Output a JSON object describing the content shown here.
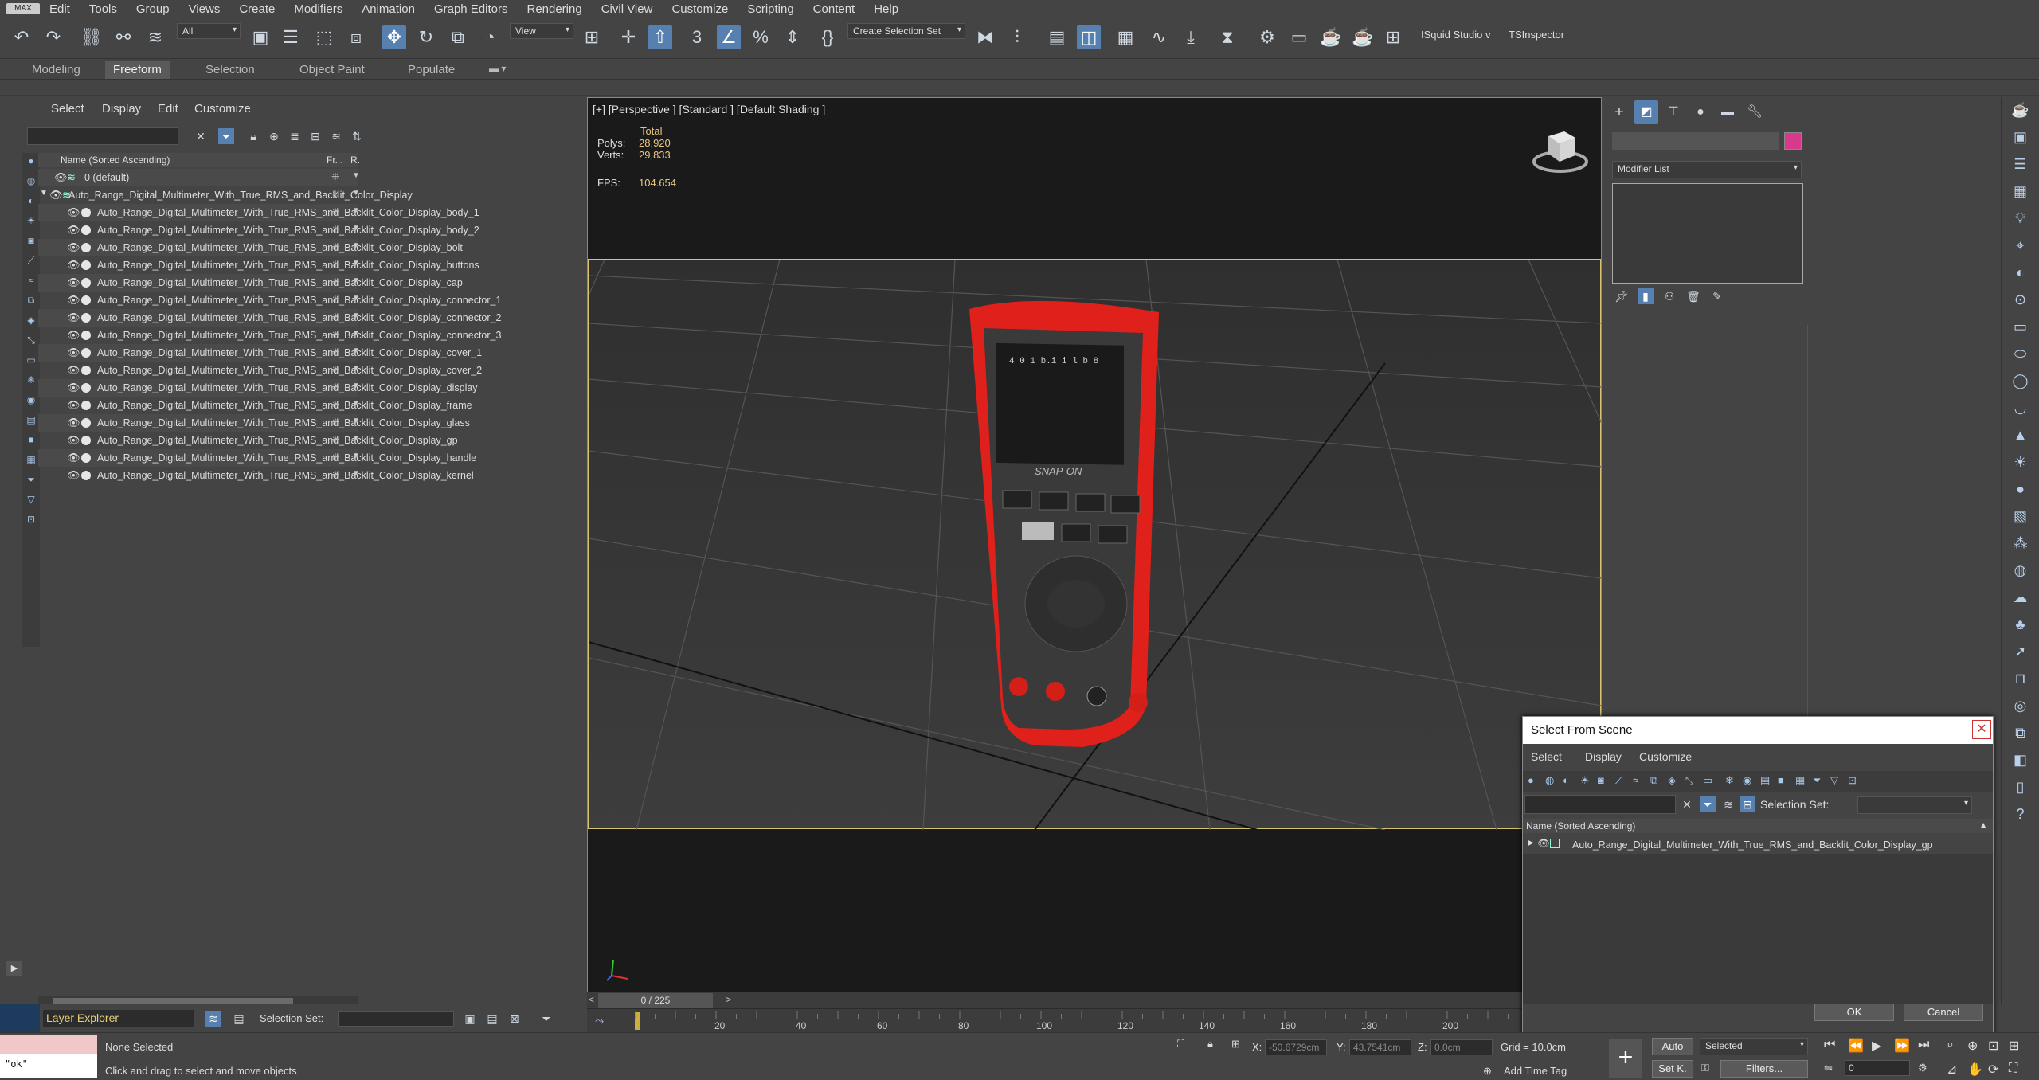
{
  "menubar": {
    "logo": "MAX",
    "items": [
      "Edit",
      "Tools",
      "Group",
      "Views",
      "Create",
      "Modifiers",
      "Animation",
      "Graph Editors",
      "Rendering",
      "Civil View",
      "Customize",
      "Scripting",
      "Content",
      "Help"
    ]
  },
  "toolbar": {
    "filter_value": "All",
    "view_value": "View",
    "selection_set_value": "Create Selection Set",
    "plugin1": "ISquid Studio v",
    "plugin2": "TSInspector"
  },
  "ribbon": {
    "tabs": [
      "Modeling",
      "Freeform",
      "Selection",
      "Object Paint",
      "Populate"
    ],
    "selected_tab": "Freeform"
  },
  "explorer": {
    "menu": [
      "Select",
      "Display",
      "Edit",
      "Customize"
    ],
    "header_name": "Name (Sorted Ascending)",
    "header_frozen": "Fr...",
    "header_r": "R.",
    "rows": [
      "0 (default)",
      "Auto_Range_Digital_Multimeter_With_True_RMS_and_Backlit_Color_Display",
      "Auto_Range_Digital_Multimeter_With_True_RMS_and_Backlit_Color_Display_body_1",
      "Auto_Range_Digital_Multimeter_With_True_RMS_and_Backlit_Color_Display_body_2",
      "Auto_Range_Digital_Multimeter_With_True_RMS_and_Backlit_Color_Display_bolt",
      "Auto_Range_Digital_Multimeter_With_True_RMS_and_Backlit_Color_Display_buttons",
      "Auto_Range_Digital_Multimeter_With_True_RMS_and_Backlit_Color_Display_cap",
      "Auto_Range_Digital_Multimeter_With_True_RMS_and_Backlit_Color_Display_connector_1",
      "Auto_Range_Digital_Multimeter_With_True_RMS_and_Backlit_Color_Display_connector_2",
      "Auto_Range_Digital_Multimeter_With_True_RMS_and_Backlit_Color_Display_connector_3",
      "Auto_Range_Digital_Multimeter_With_True_RMS_and_Backlit_Color_Display_cover_1",
      "Auto_Range_Digital_Multimeter_With_True_RMS_and_Backlit_Color_Display_cover_2",
      "Auto_Range_Digital_Multimeter_With_True_RMS_and_Backlit_Color_Display_display",
      "Auto_Range_Digital_Multimeter_With_True_RMS_and_Backlit_Color_Display_frame",
      "Auto_Range_Digital_Multimeter_With_True_RMS_and_Backlit_Color_Display_glass",
      "Auto_Range_Digital_Multimeter_With_True_RMS_and_Backlit_Color_Display_gp",
      "Auto_Range_Digital_Multimeter_With_True_RMS_and_Backlit_Color_Display_handle",
      "Auto_Range_Digital_Multimeter_With_True_RMS_and_Backlit_Color_Display_kernel"
    ],
    "layer_explorer": "Layer Explorer",
    "selection_set_label": "Selection Set:"
  },
  "viewport": {
    "label": "[+] [Perspective ] [Standard ] [Default Shading ]",
    "stats_total": "Total",
    "polys_label": "Polys:",
    "polys_value": "28,920",
    "verts_label": "Verts:",
    "verts_value": "29,833",
    "fps_label": "FPS:",
    "fps_value": "104.654",
    "brand_text": "SNAP-ON",
    "accent": "#e0201a"
  },
  "timeline": {
    "frame_display": "0 / 225",
    "ticks": [
      "20",
      "40",
      "60",
      "80",
      "100",
      "120",
      "140",
      "160",
      "180",
      "200"
    ]
  },
  "cmdpanel": {
    "modifier_list": "Modifier List",
    "color_swatch": "#d63a8c"
  },
  "dialog": {
    "title": "Select From Scene",
    "menu": [
      "Select",
      "Display",
      "Customize"
    ],
    "selection_set_label": "Selection Set:",
    "header": "Name (Sorted Ascending)",
    "item": "Auto_Range_Digital_Multimeter_With_True_RMS_and_Backlit_Color_Display_gp",
    "ok": "OK",
    "cancel": "Cancel"
  },
  "status": {
    "maxscript_output": "\"ok\"",
    "selection": "None Selected",
    "prompt": "Click and drag to select and move objects",
    "x_label": "X:",
    "x_value": "-50.6729cm",
    "y_label": "Y:",
    "y_value": "43.7541cm",
    "z_label": "Z:",
    "z_value": "0.0cm",
    "grid": "Grid = 10.0cm",
    "add_time_tag": "Add Time Tag",
    "auto": "Auto",
    "selected": "Selected",
    "set_key": "Set K.",
    "filters": "Filters...",
    "frame": "0"
  }
}
